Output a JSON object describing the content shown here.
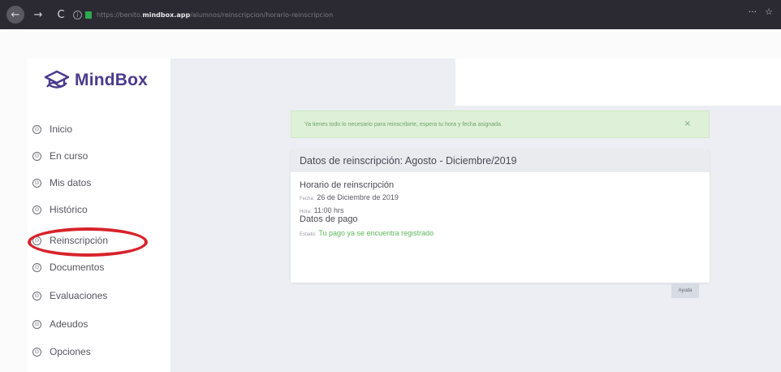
{
  "browser": {
    "nav_back": "←",
    "nav_forward": "→",
    "nav_reload": "C",
    "info_icon": "i",
    "url_prefix": "https://benito.",
    "url_domain": "mindbox.app",
    "url_path": "/alumnos/reinscripcion/horario-reinscripcion",
    "menu_dots": "···",
    "star": "☆"
  },
  "app": {
    "logo_text": "MindBox",
    "brand_color": "#4b3a8c"
  },
  "sidebar": {
    "items": [
      {
        "label": "Inicio"
      },
      {
        "label": "En curso"
      },
      {
        "label": "Mis datos"
      },
      {
        "label": "Histórico"
      },
      {
        "label": "Reinscripción"
      },
      {
        "label": "Documentos"
      },
      {
        "label": "Evaluaciones"
      },
      {
        "label": "Adeudos"
      },
      {
        "label": "Opciones"
      }
    ],
    "item_icon_glyph": "⊙"
  },
  "alert": {
    "text": "Ya tienes todo lo necesario para reinscribirte, espera tu hora y fecha asignada.",
    "close": "×",
    "color": "#dff0d8"
  },
  "card": {
    "title": "Datos de reinscripción: Agosto - Diciembre/2019",
    "schedule_title": "Horario de reinscripción",
    "fecha_label": "Fecha:",
    "fecha_value": "26 de Diciembre de 2019",
    "hora_label": "Hora:",
    "hora_value": "11:00 hrs",
    "payment_title": "Datos de pago",
    "estado_label": "Estado:",
    "estado_value": "Tu pago ya se encuentra registrado",
    "button_label": "Ayuda"
  },
  "highlight_color": "#d8232a"
}
